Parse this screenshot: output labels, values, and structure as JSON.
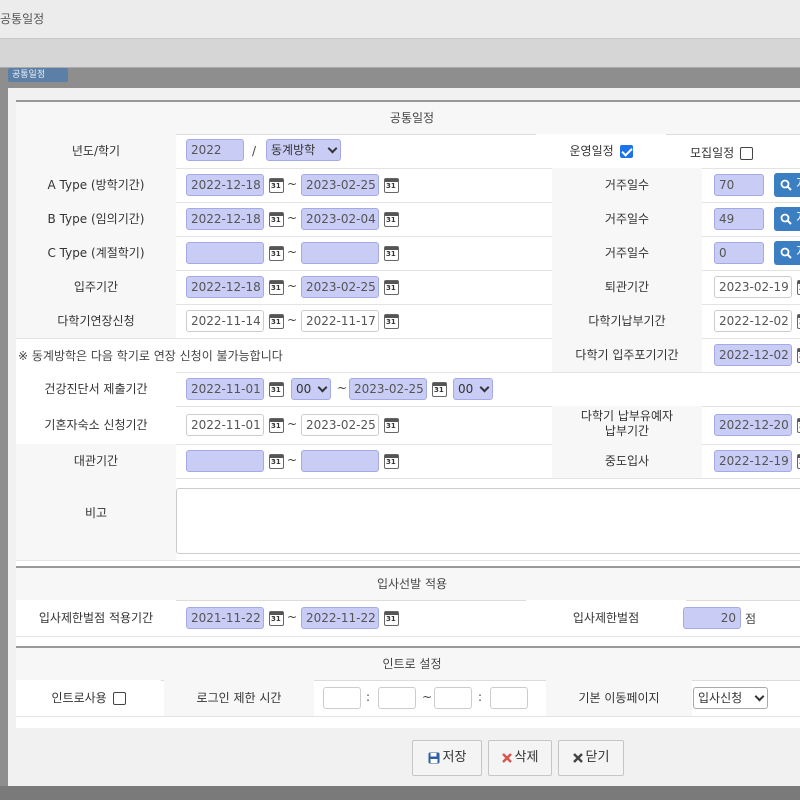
{
  "window_title": "공통일정",
  "sections": {
    "schedule": "공통일정",
    "priority": "입사선발 적용",
    "intro": "인트로 설정"
  },
  "year_semester": {
    "label": "년도/학기",
    "year": "2022",
    "separator": "/",
    "semester": "동계방학",
    "operation_label": "운영일정",
    "operation_checked": true,
    "recruit_label": "모집일정",
    "recruit_checked": false
  },
  "tilde": "~",
  "colon": ":",
  "search_label": "지",
  "type_a": {
    "label": "A Type (방학기간)",
    "start": "2022-12-18",
    "end": "2023-02-25",
    "days_label": "거주일수",
    "days": "70"
  },
  "type_b": {
    "label": "B Type (임의기간)",
    "start": "2022-12-18",
    "end": "2023-02-04",
    "days_label": "거주일수",
    "days": "49"
  },
  "type_c": {
    "label": "C Type (계절학기)",
    "start": "",
    "end": "",
    "days_label": "거주일수",
    "days": "0"
  },
  "move_in": {
    "label": "입주기간",
    "start": "2022-12-18",
    "end": "2023-02-25",
    "checkout_label": "퇴관기간",
    "checkout_date": "2023-02-19"
  },
  "extension": {
    "label": "다학기연장신청",
    "start": "2022-11-14",
    "end": "2022-11-17",
    "pay_label": "다학기납부기간",
    "pay_date": "2022-12-02"
  },
  "notice": {
    "text": "※ 동계방학은 다음 학기로 연장 신청이 불가능합니다",
    "giveup_label": "다학기 입주포기기간",
    "giveup_date": "2022-12-02"
  },
  "health": {
    "label": "건강진단서 제출기간",
    "start": "2022-11-01",
    "start_hour": "00",
    "end": "2023-02-25",
    "end_hour": "00"
  },
  "married": {
    "label": "기혼자숙소 신청기간",
    "start": "2022-11-01",
    "end": "2023-02-25",
    "deferral_label_1": "다학기 납부유예자",
    "deferral_label_2": "납부기간",
    "deferral_date": "2022-12-20"
  },
  "rental": {
    "label": "대관기간",
    "start": "",
    "end": "",
    "midterm_label": "중도입사",
    "midterm_date": "2022-12-19"
  },
  "remarks": {
    "label": "비고",
    "value": ""
  },
  "penalty": {
    "period_label": "입사제한벌점 적용기간",
    "start": "2021-11-22",
    "end": "2022-11-22",
    "limit_label": "입사제한벌점",
    "limit_value": "20",
    "unit": "점"
  },
  "intro": {
    "use_label": "인트로사용",
    "use_checked": false,
    "login_limit_label": "로그인 제한 시간",
    "start_hour": "",
    "start_min": "",
    "end_hour": "",
    "end_min": "",
    "default_page_label": "기본 이동페이지",
    "default_page": "입사신청"
  },
  "buttons": {
    "save": "저장",
    "delete": "삭제",
    "close": "닫기"
  },
  "colors": {
    "highlight_field": "#c9cdf5",
    "search_button": "#3b7fc2",
    "checkbox_on": "#1e73e8",
    "delete_icon": "#d9534f",
    "save_icon": "#2f5f9e"
  },
  "bg_tab_label": "공통일정"
}
